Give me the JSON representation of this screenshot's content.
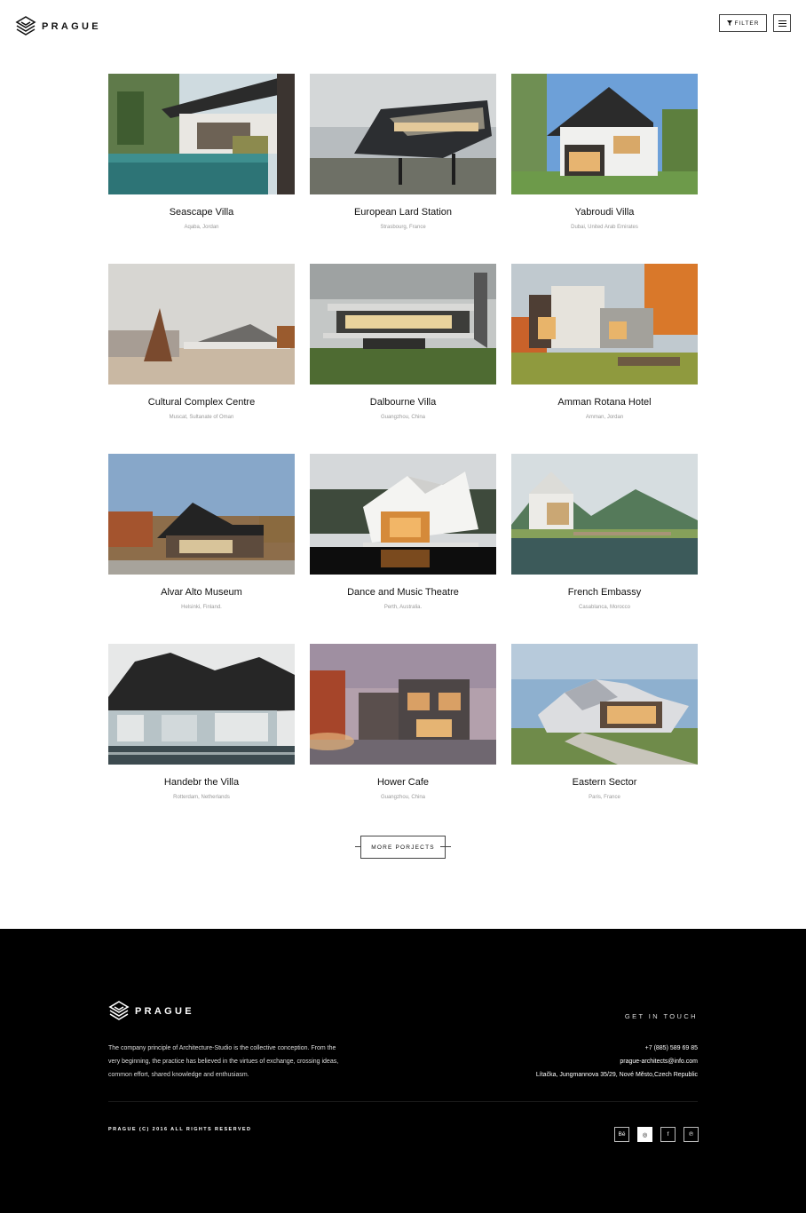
{
  "header": {
    "logo_text": "PRAGUE",
    "filter_label": "FILTER"
  },
  "projects": [
    {
      "title": "Seascape Villa",
      "location": "Aqaba, Jordan"
    },
    {
      "title": "European Lard Station",
      "location": "Strasbourg, France"
    },
    {
      "title": "Yabroudi Villa",
      "location": "Dubai, United Arab Emirates"
    },
    {
      "title": "Cultural Complex Centre",
      "location": "Muscat, Sultanate of Oman"
    },
    {
      "title": "Dalbourne Villa",
      "location": "Guangzhou, China"
    },
    {
      "title": "Amman Rotana Hotel",
      "location": "Amman, Jordan"
    },
    {
      "title": "Alvar Alto Museum",
      "location": "Helsinki, Finland."
    },
    {
      "title": "Dance and Music Theatre",
      "location": "Perth, Australia."
    },
    {
      "title": "French Embassy",
      "location": "Casablanca, Morocco"
    },
    {
      "title": "Handebr the Villa",
      "location": "Rotterdam, Netherlands"
    },
    {
      "title": "Hower Cafe",
      "location": "Guangzhou, China"
    },
    {
      "title": "Eastern Sector",
      "location": "Paris, France"
    }
  ],
  "more_label": "MORE PORJECTS",
  "footer": {
    "logo_text": "PRAGUE",
    "description": "The company principle of Architecture-Studio is the collective conception. From the very beginning, the practice has believed in the virtues of exchange, crossing ideas, common effort, shared knowledge and enthusiasm.",
    "get_in_touch": "GET IN TOUCH",
    "phone": "+7 (885) 589 69 85",
    "email": "prague-architects@info.com",
    "address": "Lítačka, Jungmannova 35/29, Nové Město,Czech Republic",
    "copyright": "PRAGUE (C) 2016 ALL RIGHTS RESERVED",
    "socials": [
      {
        "icon": "behance-icon",
        "glyph": "Bē"
      },
      {
        "icon": "dribbble-icon",
        "glyph": "◎"
      },
      {
        "icon": "facebook-icon",
        "glyph": "f"
      },
      {
        "icon": "pinterest-icon",
        "glyph": "℗"
      }
    ]
  }
}
